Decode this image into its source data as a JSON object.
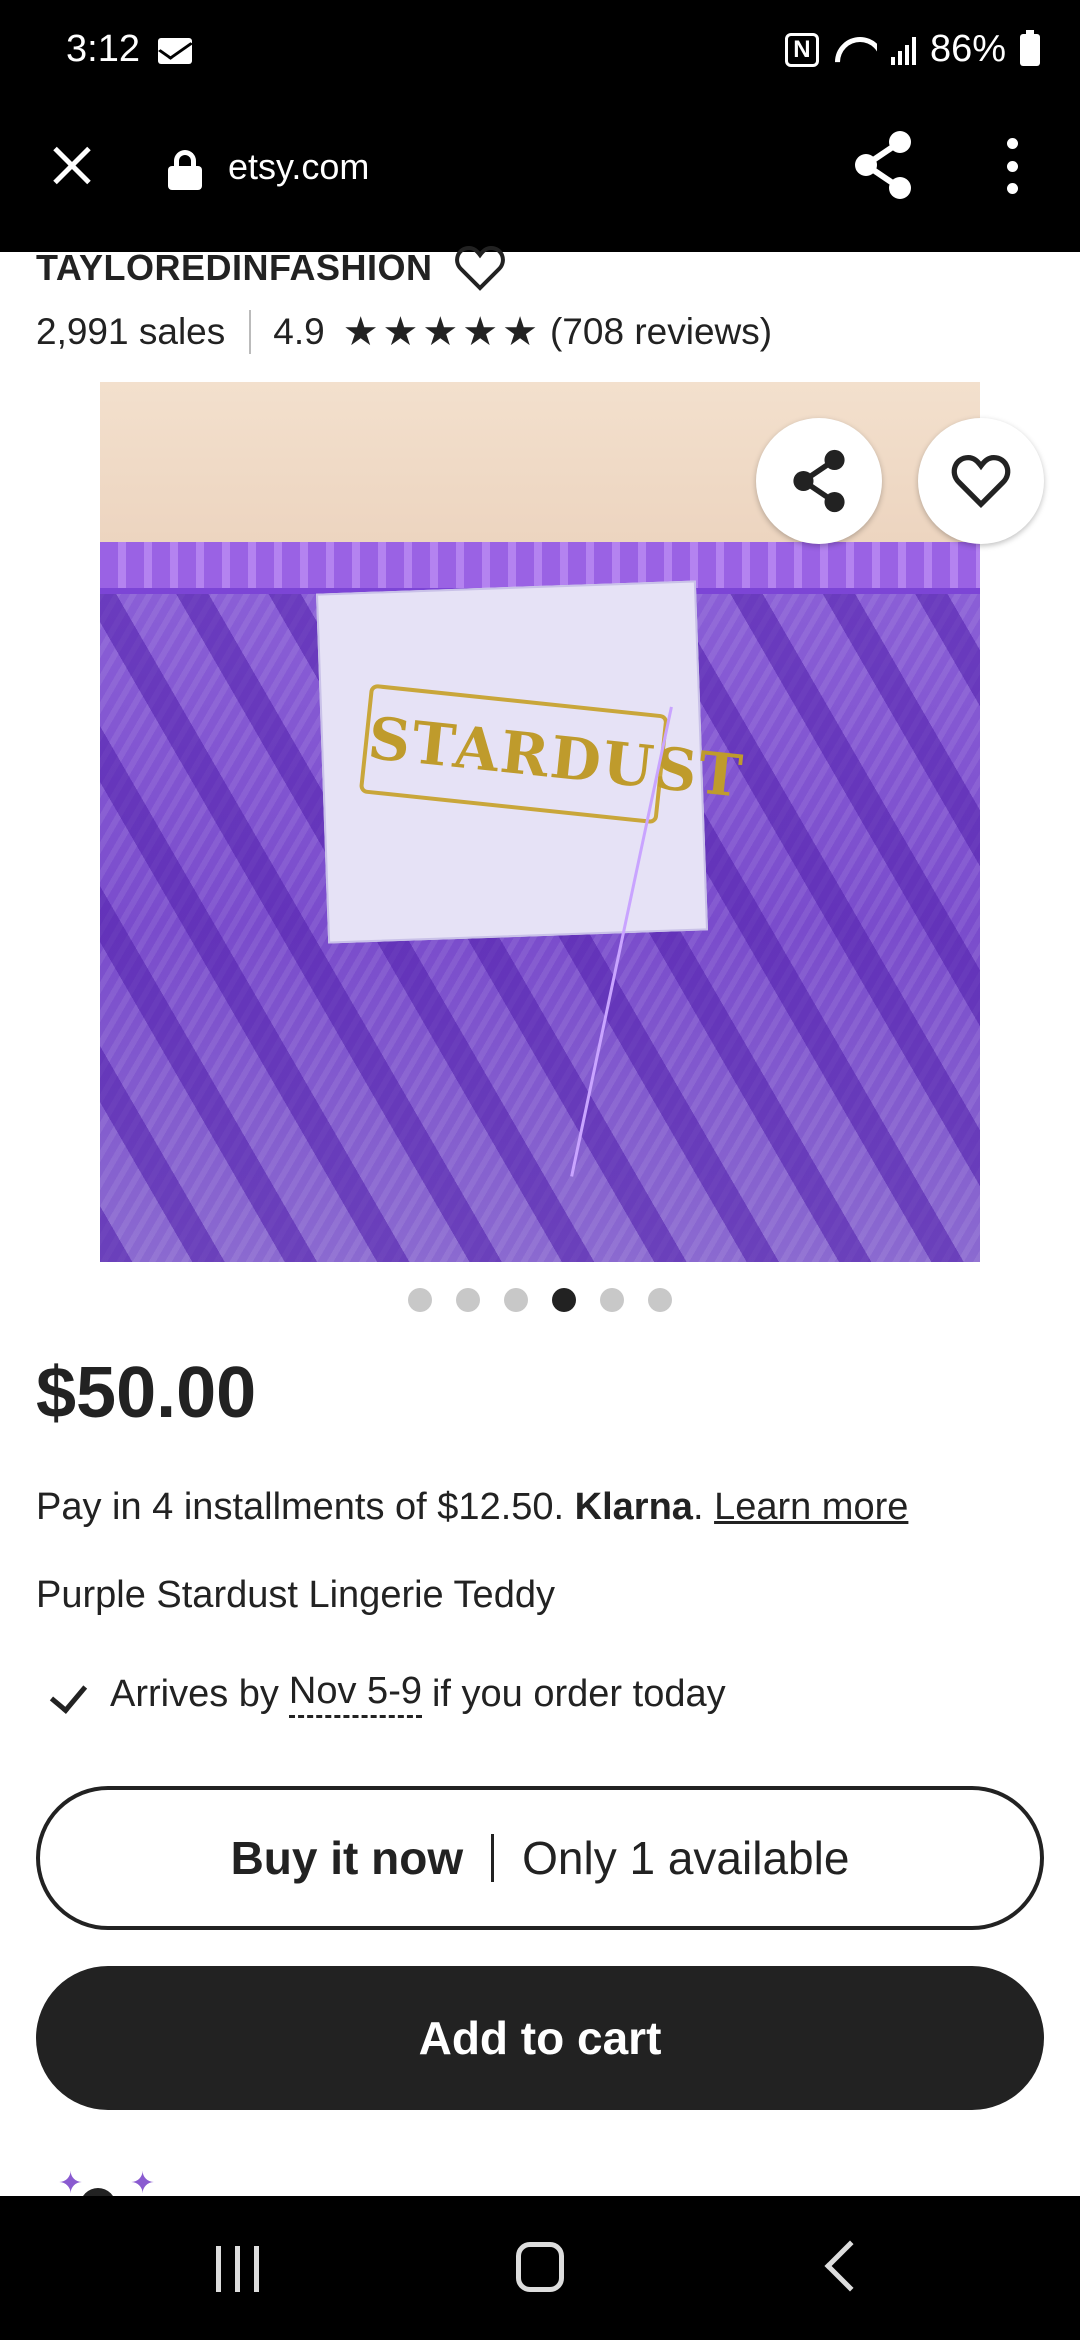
{
  "status_bar": {
    "time": "3:12",
    "nfc_label": "N",
    "battery": "86%"
  },
  "browser": {
    "url": "etsy.com"
  },
  "shop": {
    "name": "TAYLOREDINFASHION",
    "sales": "2,991 sales",
    "rating": "4.9",
    "stars": 5,
    "reviews": "(708 reviews)"
  },
  "gallery": {
    "label_text": "STARDUST",
    "image_count": 6,
    "active_index": 3
  },
  "product": {
    "price": "$50.00",
    "klarna_prefix": "Pay in 4 installments of $12.50.",
    "klarna_brand": "Klarna",
    "klarna_period": ".",
    "learn_more": "Learn more",
    "title": "Purple Stardust Lingerie Teddy",
    "arrives_prefix": "Arrives by",
    "arrives_date": "Nov 5-9",
    "arrives_suffix": "if you order today"
  },
  "actions": {
    "buy_now": "Buy it now",
    "availability": "Only 1 available",
    "add_to_cart": "Add to cart"
  },
  "colors": {
    "dark": "#222222",
    "accent_purple": "#8a5bd0"
  }
}
